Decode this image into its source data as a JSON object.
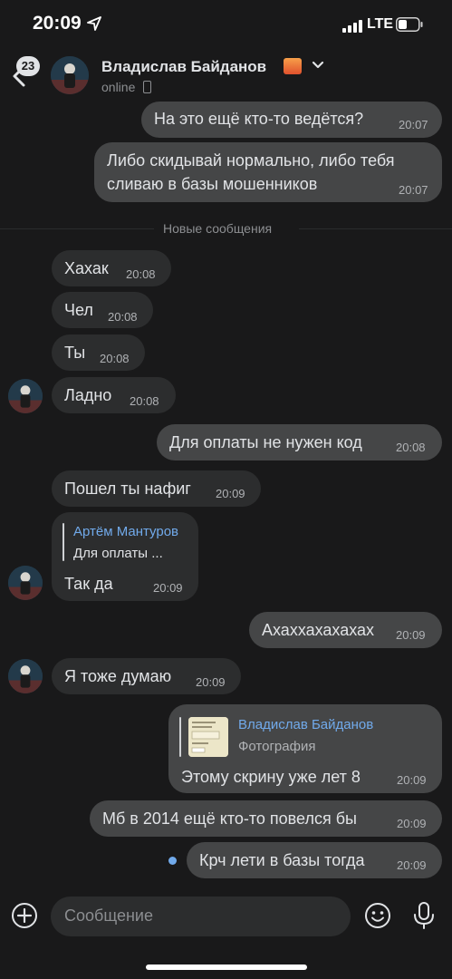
{
  "status_bar": {
    "time": "20:09",
    "network": "LTE"
  },
  "header": {
    "unread_badge": "23",
    "contact_name": "Владислав Байданов",
    "status": "online"
  },
  "divider": {
    "label": "Новые сообщения"
  },
  "messages": [
    {
      "text": "На это ещё кто-то ведётся?",
      "time": "20:07"
    },
    {
      "text_line1": "Либо скидывай нормально, либо тебя",
      "text_line2": "сливаю в базы мошенников",
      "time": "20:07"
    },
    {
      "text": "Хахак",
      "time": "20:08"
    },
    {
      "text": "Чел",
      "time": "20:08"
    },
    {
      "text": "Ты",
      "time": "20:08"
    },
    {
      "text": "Ладно",
      "time": "20:08"
    },
    {
      "text": "Для оплаты не нужен код",
      "time": "20:08"
    },
    {
      "text": "Пошел ты нафиг",
      "time": "20:09"
    },
    {
      "reply_name": "Артём Мантуров",
      "reply_text": "Для оплаты ...",
      "text": "Так да",
      "time": "20:09"
    },
    {
      "text": "Ахаххахахахах",
      "time": "20:09"
    },
    {
      "text": "Я тоже думаю",
      "time": "20:09"
    },
    {
      "reply_name": "Владислав Байданов",
      "reply_text": "Фотография",
      "text": "Этому скрину уже лет 8",
      "time": "20:09"
    },
    {
      "text": "Мб в 2014 ещё кто-то повелся бы",
      "time": "20:09"
    },
    {
      "text": "Крч лети в базы тогда",
      "time": "20:09"
    }
  ],
  "composer": {
    "placeholder": "Сообщение"
  },
  "colors": {
    "background": "#19191a",
    "incoming": "#2c2d2e",
    "outgoing": "#454647",
    "accent": "#71aaeb"
  }
}
